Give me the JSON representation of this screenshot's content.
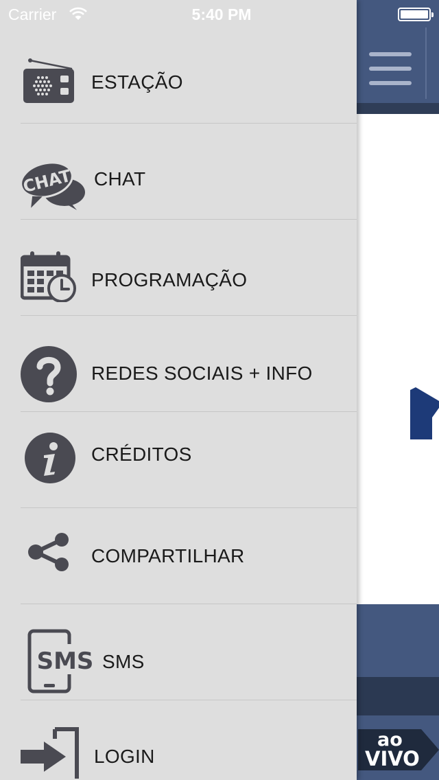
{
  "status_bar": {
    "carrier": "Carrier",
    "time": "5:40 PM"
  },
  "menu": {
    "items": [
      {
        "label": "ESTAÇÃO",
        "icon": "radio-icon"
      },
      {
        "label": "CHAT",
        "icon": "chat-bubble-icon",
        "icon_text": "CHAT"
      },
      {
        "label": "PROGRAMAÇÃO",
        "icon": "calendar-clock-icon"
      },
      {
        "label": "REDES SOCIAIS + INFO",
        "icon": "question-icon"
      },
      {
        "label": "CRÉDITOS",
        "icon": "info-icon"
      },
      {
        "label": "COMPARTILHAR",
        "icon": "share-icon"
      },
      {
        "label": "SMS",
        "icon": "sms-phone-icon",
        "icon_text": "SMS"
      },
      {
        "label": "LOGIN",
        "icon": "login-icon"
      }
    ]
  },
  "live_badge": {
    "line1": "ao",
    "line2": "VIVO"
  },
  "colors": {
    "drawer_bg": "#dedede",
    "icon": "#4a4a52",
    "header_blue": "#44587f",
    "header_dark": "#2f3d57",
    "logo_blue": "#1d3a78",
    "text": "#1a1a1a"
  }
}
